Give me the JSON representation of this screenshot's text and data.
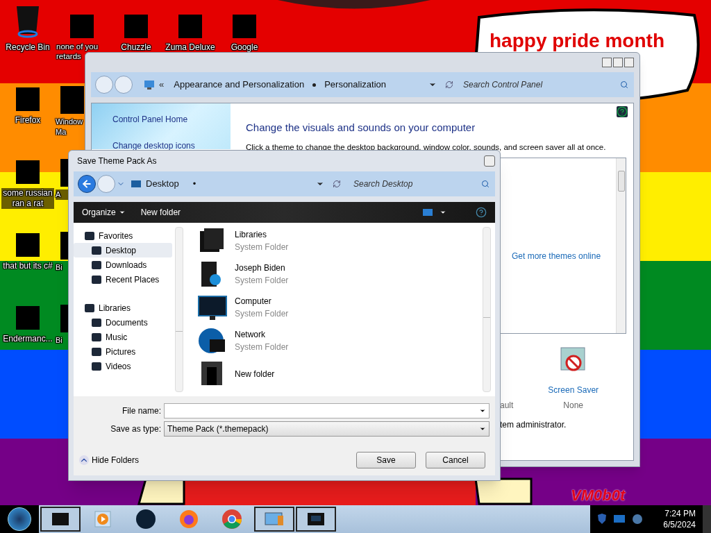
{
  "wallpaper": {
    "bubble_text": "happy pride month",
    "signature": "VM0b0t"
  },
  "desktop_icons": [
    {
      "label": "Recycle Bin",
      "kind": "bin"
    },
    {
      "label": "none of you retards",
      "kind": "censored"
    },
    {
      "label": "Chuzzle",
      "kind": "censored"
    },
    {
      "label": "Zuma Deluxe",
      "kind": "censored"
    },
    {
      "label": "Google",
      "kind": "censored"
    },
    {
      "label": "Firefox",
      "kind": "censored"
    },
    {
      "label": "Window Ma",
      "kind": "censored"
    },
    {
      "label": "some russian ran a rat",
      "kind": "censored"
    },
    {
      "label": "A",
      "kind": "censored"
    },
    {
      "label": "that but its c#",
      "kind": "censored"
    },
    {
      "label": "Bi",
      "kind": "censored"
    },
    {
      "label": "Endermanc...",
      "kind": "censored"
    },
    {
      "label": "Bi",
      "kind": "censored"
    }
  ],
  "control_panel": {
    "breadcrumbs": [
      "«",
      "Appearance and Personalization",
      "Personalization"
    ],
    "search": {
      "placeholder": "Search Control Panel"
    },
    "links": [
      "Control Panel Home",
      "Change desktop icons"
    ],
    "heading": "Change the visuals and sounds on your computer",
    "description": "Click a theme to change the desktop background, window color, sounds, and screen saver all at once.",
    "themes_link": "Get more themes online",
    "partial_texts": [
      "ault",
      "tem administrator."
    ],
    "screen_saver": {
      "label": "Screen Saver",
      "value": "None"
    }
  },
  "dialog": {
    "title": "Save Theme Pack As",
    "location": "Desktop",
    "location_mark": "•",
    "search": {
      "placeholder": "Search Desktop"
    },
    "toolbar": [
      "Organize",
      "New folder"
    ],
    "nav": [
      {
        "label": "Favorites",
        "kind": "header",
        "selected": false
      },
      {
        "label": "Desktop",
        "kind": "item",
        "selected": true
      },
      {
        "label": "Downloads",
        "kind": "item",
        "selected": false
      },
      {
        "label": "Recent Places",
        "kind": "item",
        "selected": false
      },
      {
        "label": "Libraries",
        "kind": "header",
        "selected": false
      },
      {
        "label": "Documents",
        "kind": "item",
        "selected": false
      },
      {
        "label": "Music",
        "kind": "item",
        "selected": false
      },
      {
        "label": "Pictures",
        "kind": "item",
        "selected": false
      },
      {
        "label": "Videos",
        "kind": "item",
        "selected": false
      }
    ],
    "files": [
      {
        "name": "Libraries",
        "type": "System Folder"
      },
      {
        "name": "Joseph Biden",
        "type": "System Folder"
      },
      {
        "name": "Computer",
        "type": "System Folder"
      },
      {
        "name": "Network",
        "type": "System Folder"
      },
      {
        "name": "New folder"
      }
    ],
    "file_name": {
      "label": "File name:"
    },
    "save_type": {
      "label": "Save as type:",
      "value": "Theme Pack (*.themepack)"
    },
    "hide_folders": "Hide Folders",
    "buttons": [
      "Save",
      "Cancel"
    ]
  },
  "taskbar": {
    "items": [
      {
        "kind": "box",
        "open": true
      },
      {
        "kind": "media",
        "open": false
      },
      {
        "kind": "orb",
        "open": false
      },
      {
        "kind": "firefox",
        "open": false
      },
      {
        "kind": "chrome",
        "open": false
      },
      {
        "kind": "panel",
        "open": true
      },
      {
        "kind": "screen",
        "open": true
      }
    ],
    "time": "7:24 PM",
    "date": "6/5/2024"
  }
}
